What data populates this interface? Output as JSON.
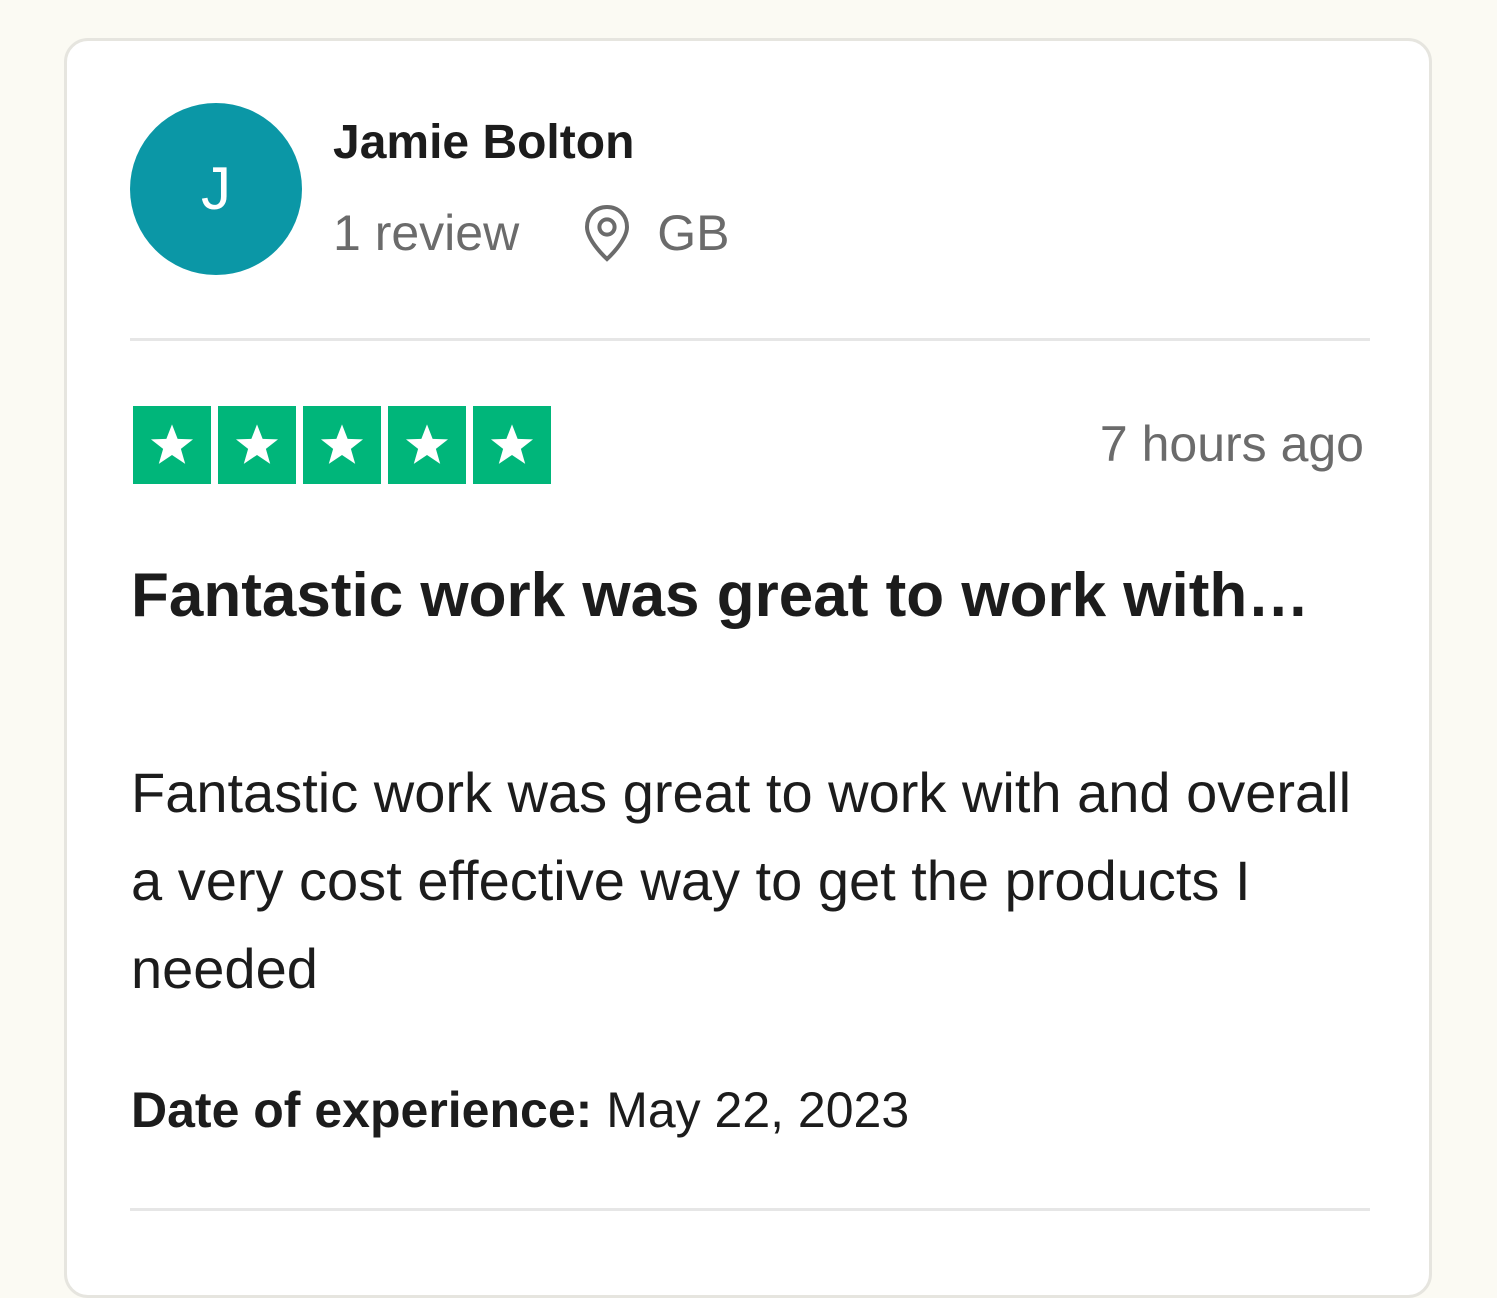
{
  "reviewer": {
    "initial": "J",
    "name": "Jamie Bolton",
    "review_count": "1 review",
    "location_icon": "map-pin-icon",
    "country": "GB",
    "avatar_color": "#0b97a6"
  },
  "rating": {
    "stars": 5,
    "max_stars": 5,
    "color": "#00b67a"
  },
  "timestamp": "7 hours ago",
  "review": {
    "title": "Fantastic work was great to work with…",
    "body": "Fantastic work was great to work with and overall a very cost effective way to get the products I needed"
  },
  "experience": {
    "label": "Date of experience:",
    "date": "May 22, 2023"
  }
}
